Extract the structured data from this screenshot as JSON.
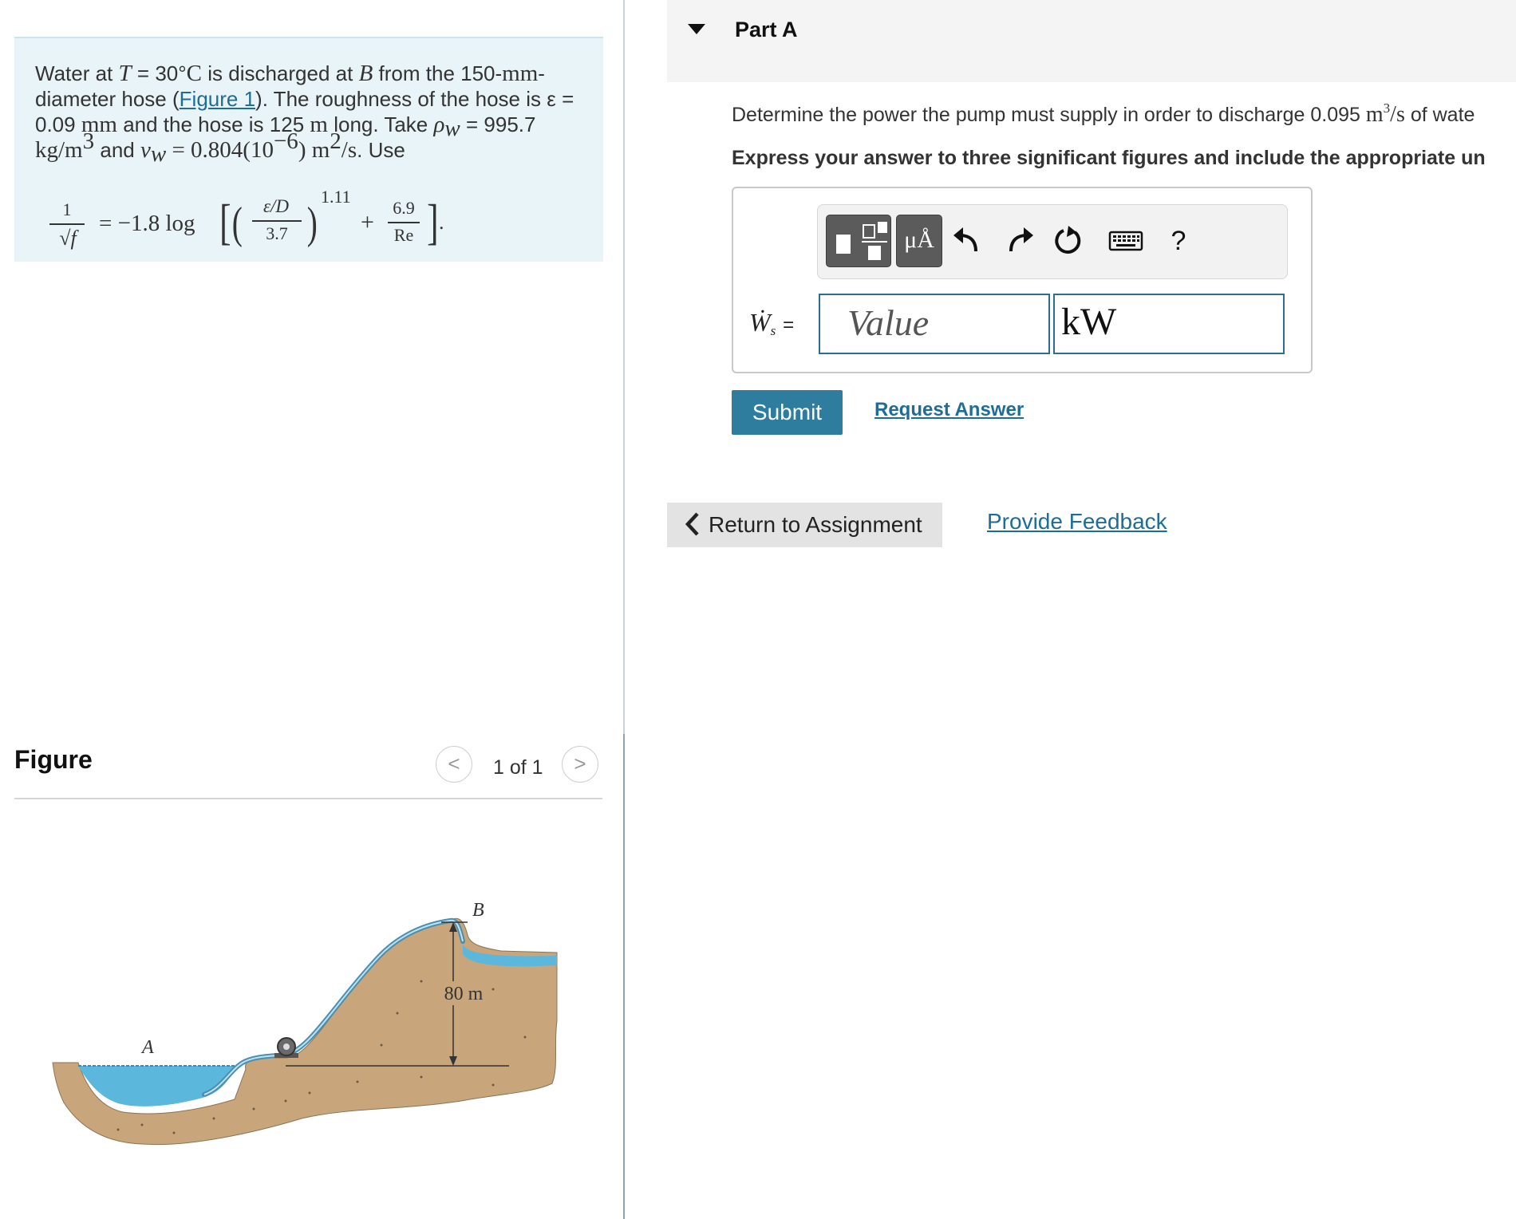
{
  "problem": {
    "t1": "Water at",
    "T": "T",
    "eq": "=",
    "temp": "30°",
    "C": "C",
    "t2": "is discharged at",
    "B": "B",
    "t3": "from the 150-",
    "mm": "mm",
    "dash": "-",
    "t4": "diameter hose (",
    "figure_link": "Figure 1",
    "t5": "). The roughness of the hose is",
    "eps_eq": "ε =",
    "eps_val": "0.09",
    "eps_unit": "mm",
    "t6": "and the hose is 125",
    "m": "m",
    "t7": "long. Take",
    "rho": "ρ",
    "rho_sub": "w",
    "rho_val": "= 995.7",
    "kg": "kg/m",
    "three": "3",
    "and": "and",
    "nu": "ν",
    "nu_sub": "w",
    "nu_val": "= 0.804(10",
    "nu_exp": "−6",
    "nu_close": ") m",
    "two": "2",
    "per_s": "/s",
    "use": ". Use",
    "formula": {
      "one": "1",
      "sqrtf": "√f",
      "eq_log": "= −1.8 log",
      "eps_d": "ε/D",
      "three_seven": "3.7",
      "exp": "1.11",
      "plus": "+",
      "six_nine": "6.9",
      "re": "Re",
      "dot": "."
    }
  },
  "figure": {
    "title": "Figure",
    "pager": "1 of 1",
    "prev": "<",
    "next": ">",
    "label_a": "A",
    "label_b": "B",
    "label_height": "80 m"
  },
  "part": {
    "title": "Part A",
    "q1": "Determine the power the pump must supply in order to discharge 0.095",
    "q_unit": "m",
    "q_exp": "3",
    "q_unit2": "/s",
    "q2": "of wate",
    "instruction": "Express your answer to three significant figures and include the appropriate un"
  },
  "answer": {
    "label": "Ẇ",
    "label_sub": "s",
    "label_eq": "=",
    "value_placeholder": "Value",
    "unit_value": "kW",
    "tb_units": "μÅ",
    "tb_help": "?"
  },
  "actions": {
    "submit": "Submit",
    "request_answer": "Request Answer",
    "return": "Return to Assignment",
    "feedback": "Provide Feedback"
  },
  "colors": {
    "problem_bg": "#e8f4f7",
    "accent": "#2e7d9f",
    "link": "#1f6d96",
    "water": "#5bb8dc",
    "ground": "#c9a57b"
  }
}
